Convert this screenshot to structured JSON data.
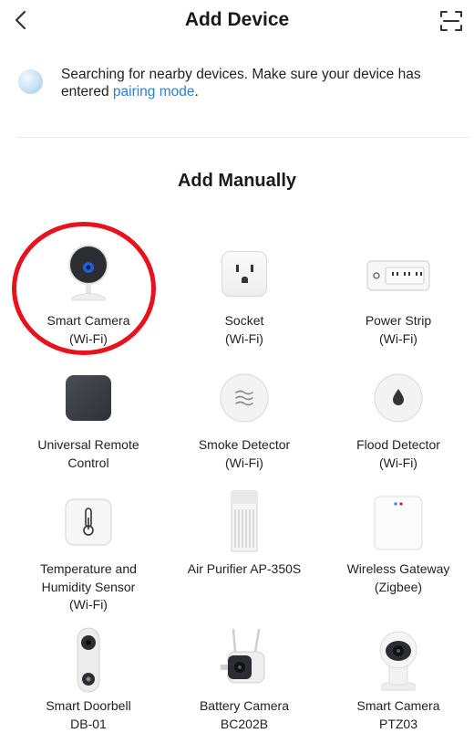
{
  "header": {
    "title": "Add Device",
    "back_icon": "chevron-left-icon",
    "scan_icon": "scan-icon"
  },
  "searching": {
    "text": "Searching for nearby devices. Make sure your device has entered ",
    "link": "pairing mode",
    "suffix": "."
  },
  "section": {
    "title": "Add Manually"
  },
  "devices": [
    {
      "line1": "Smart Camera",
      "line2": "(Wi-Fi)",
      "line3": "",
      "icon": "smart-camera-icon",
      "highlighted": true
    },
    {
      "line1": "Socket",
      "line2": "(Wi-Fi)",
      "line3": "",
      "icon": "socket-icon"
    },
    {
      "line1": "Power Strip",
      "line2": "(Wi-Fi)",
      "line3": "",
      "icon": "power-strip-icon"
    },
    {
      "line1": "Universal Remote",
      "line2": "Control",
      "line3": "",
      "icon": "universal-remote-icon"
    },
    {
      "line1": "Smoke Detector",
      "line2": "(Wi-Fi)",
      "line3": "",
      "icon": "smoke-detector-icon"
    },
    {
      "line1": "Flood Detector",
      "line2": "(Wi-Fi)",
      "line3": "",
      "icon": "flood-detector-icon"
    },
    {
      "line1": "Temperature and",
      "line2": "Humidity Sensor",
      "line3": "(Wi-Fi)",
      "icon": "thermometer-icon"
    },
    {
      "line1": "Air Purifier AP-350S",
      "line2": "",
      "line3": "",
      "icon": "air-purifier-icon"
    },
    {
      "line1": "Wireless Gateway",
      "line2": "(Zigbee)",
      "line3": "",
      "icon": "wireless-gateway-icon"
    },
    {
      "line1": "Smart Doorbell",
      "line2": "DB-01",
      "line3": "",
      "icon": "smart-doorbell-icon"
    },
    {
      "line1": "Battery Camera",
      "line2": "BC202B",
      "line3": "",
      "icon": "battery-camera-icon"
    },
    {
      "line1": "Smart Camera",
      "line2": "PTZ03",
      "line3": "",
      "icon": "ptz-camera-icon"
    }
  ],
  "colors": {
    "link": "#2f7fd4",
    "highlight": "#e8121d"
  }
}
